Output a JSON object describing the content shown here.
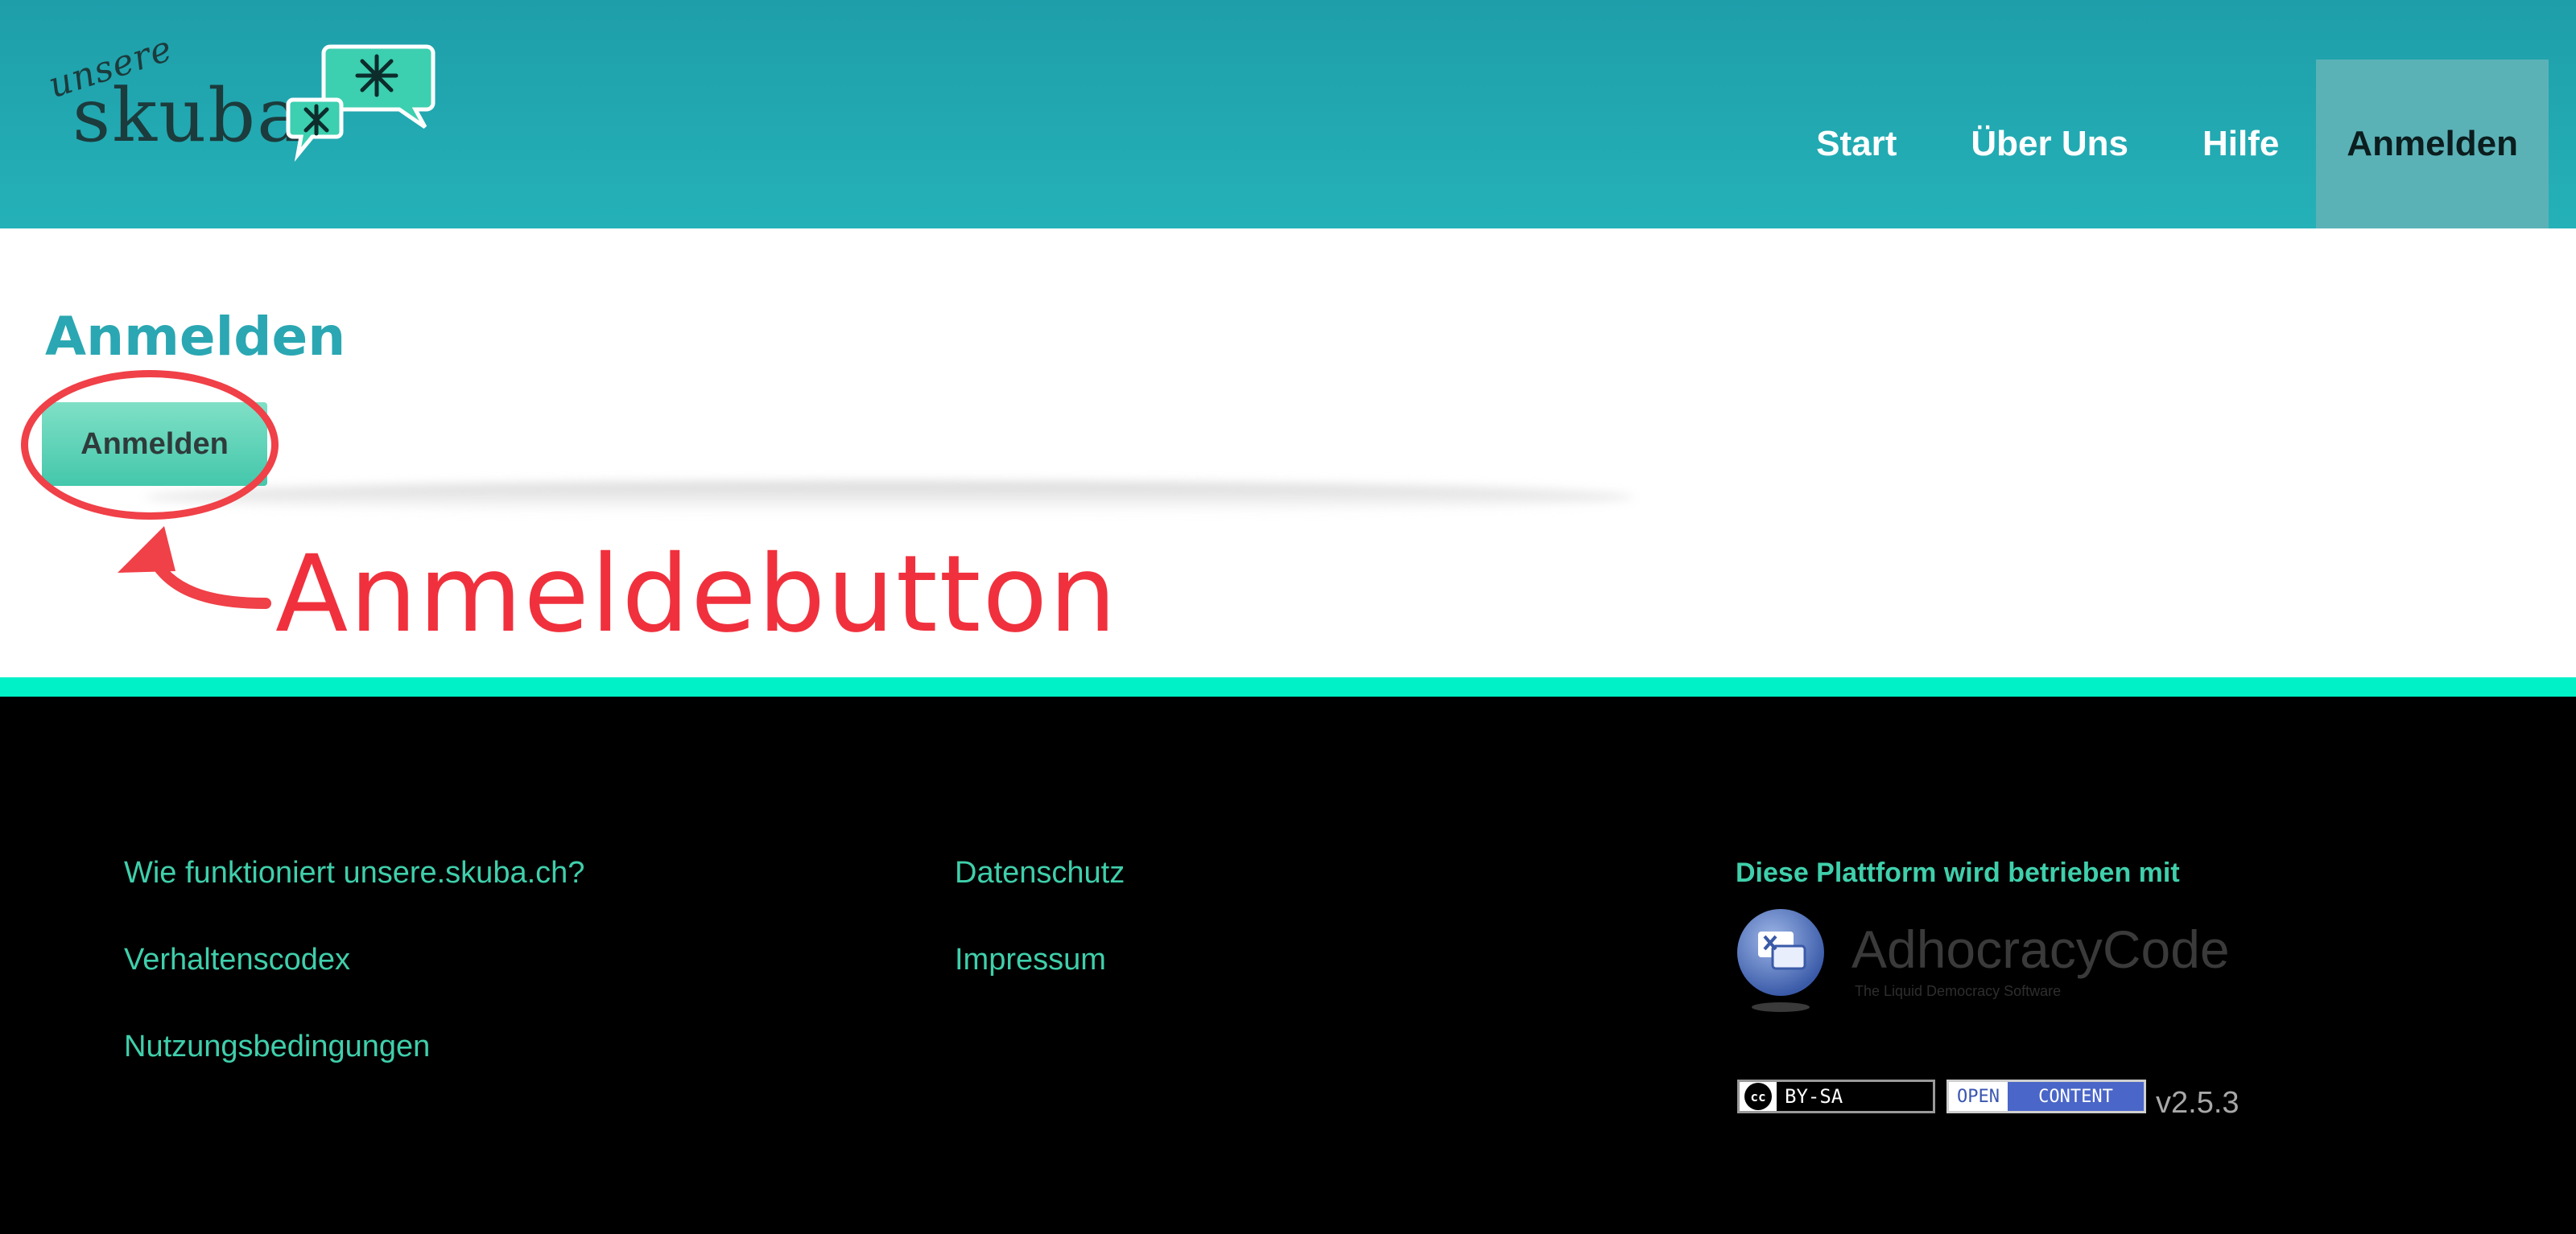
{
  "logo": {
    "small_text": "unsere",
    "big_text": "skuba"
  },
  "nav": {
    "items": [
      {
        "label": "Start"
      },
      {
        "label": "Über Uns"
      },
      {
        "label": "Hilfe"
      },
      {
        "label": "Anmelden"
      }
    ],
    "active": "Anmelden"
  },
  "main": {
    "title": "Anmelden",
    "login_button": "Anmelden"
  },
  "annotation": {
    "label": "Anmeldebutton",
    "color": "#f0313d"
  },
  "footer": {
    "col1": [
      "Wie funktioniert unsere.skuba.ch?",
      "Verhaltenscodex",
      "Nutzungsbedingungen"
    ],
    "col2": [
      "Datenschutz",
      "Impressum"
    ],
    "powered_by": "Diese Plattform wird betrieben mit",
    "adhocracy": {
      "name": "AdhocracyCode",
      "tagline": "The Liquid Democracy Software"
    },
    "license_badge": {
      "cc": "cc",
      "text": "BY-SA"
    },
    "open_content_badge": {
      "open": "OPEN",
      "content": "CONTENT"
    },
    "version": "v2.5.3"
  },
  "colors": {
    "header": "#22aab3",
    "accent": "#3fcfab",
    "footer_bg": "#000000",
    "footer_line": "#00f0c8"
  }
}
